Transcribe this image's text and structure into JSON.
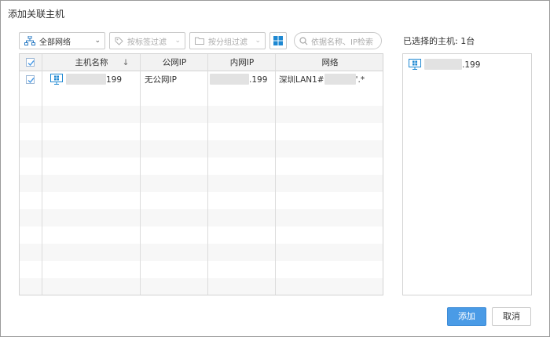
{
  "dialog": {
    "title": "添加关联主机"
  },
  "toolbar": {
    "network_select": "全部网络",
    "tag_filter": "按标签过滤",
    "group_filter": "按分组过滤",
    "search_placeholder": "依据名称、IP检索"
  },
  "table": {
    "columns": [
      "主机名称",
      "公网IP",
      "内网IP",
      "网络"
    ],
    "sort_icon": "↓",
    "rows": [
      {
        "checked": true,
        "name_suffix": "199",
        "public_ip": "无公网IP",
        "private_ip_suffix": ".199",
        "network_prefix": "深圳LAN1#",
        "network_suffix": "'.*"
      }
    ]
  },
  "selected": {
    "label": "已选择的主机: 1台",
    "items": [
      {
        "name_suffix": ".199"
      }
    ]
  },
  "buttons": {
    "add": "添加",
    "cancel": "取消"
  },
  "colors": {
    "primary": "#4a9be6",
    "windows_blue": "#1e88d2"
  }
}
